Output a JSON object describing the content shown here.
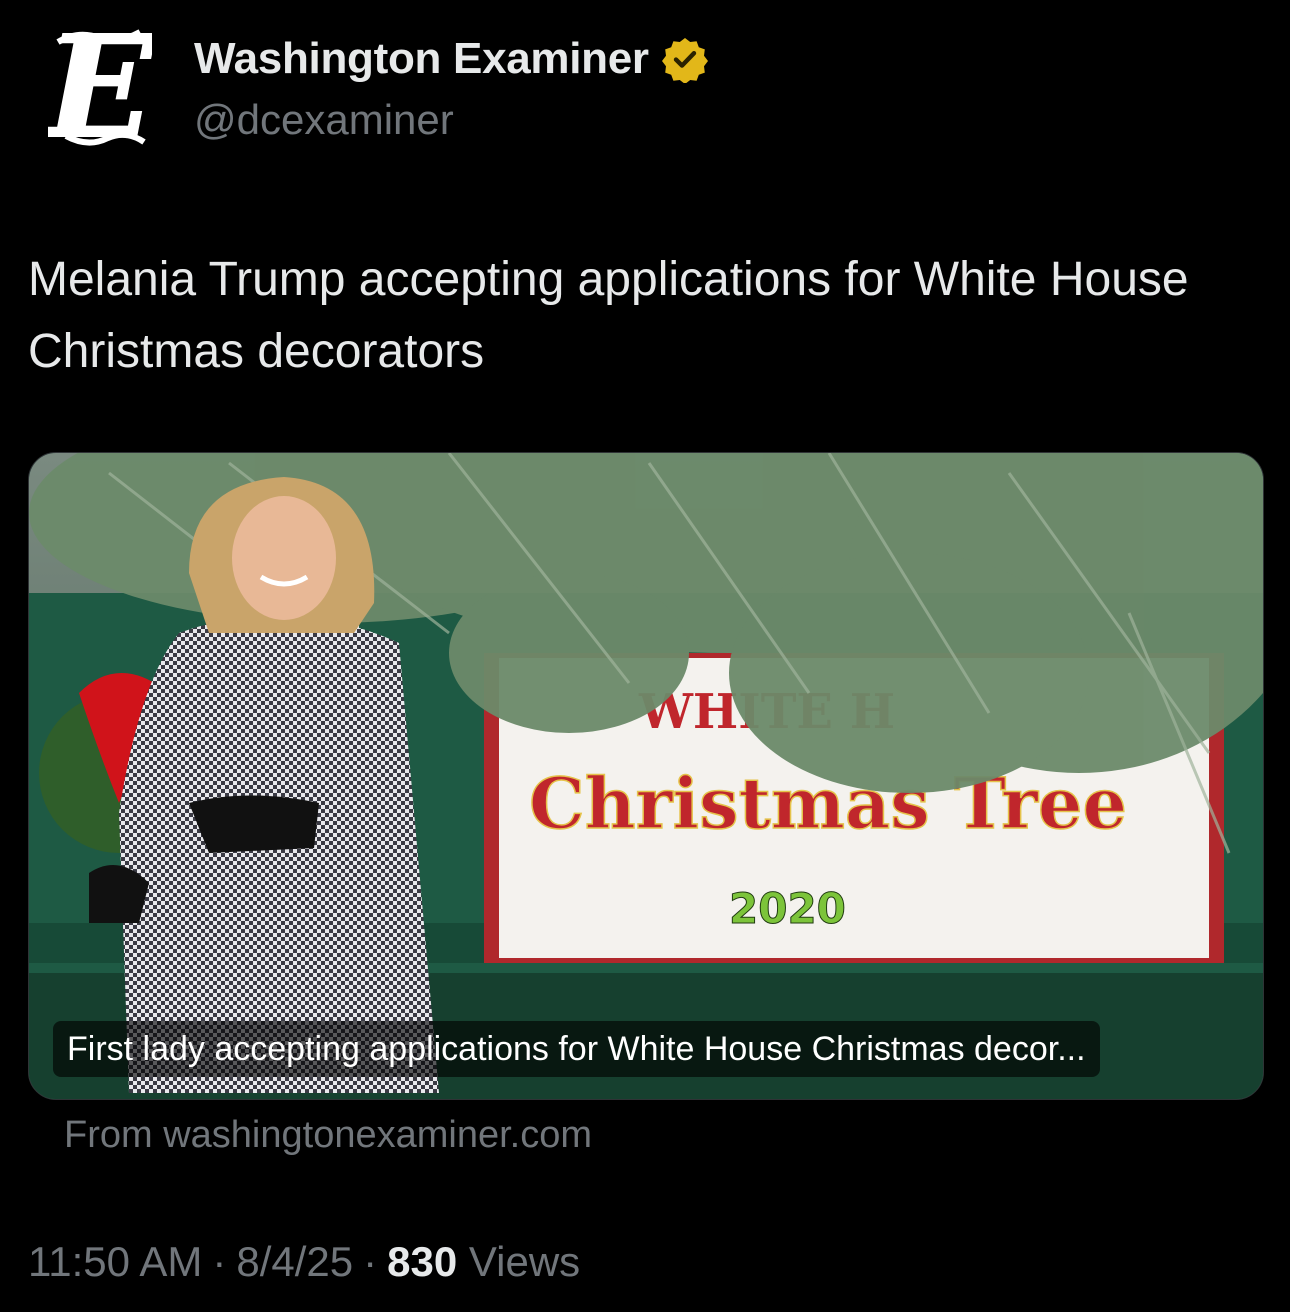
{
  "author": {
    "display_name": "Washington Examiner",
    "handle": "@dcexaminer",
    "verified": true,
    "verified_color": "#e2b719",
    "avatar_icon": "gothic-e-logo-icon"
  },
  "tweet": {
    "text": "Melania Trump accepting applications for White House Christmas decorators"
  },
  "link_card": {
    "image_signage": {
      "line1": "WHITE H",
      "line2": "Christmas Tree",
      "line3": "2020"
    },
    "caption": "First lady accepting applications for White House Christmas decor...",
    "source": "From washingtonexaminer.com"
  },
  "meta": {
    "time": "11:50 AM",
    "separator": "·",
    "date": "8/4/25",
    "views_count": "830",
    "views_label": "Views"
  },
  "colors": {
    "background": "#000000",
    "primary_text": "#e7e9ea",
    "secondary_text": "#71767b",
    "sign_red": "#c0262c",
    "sign_green": "#7cc43a"
  }
}
